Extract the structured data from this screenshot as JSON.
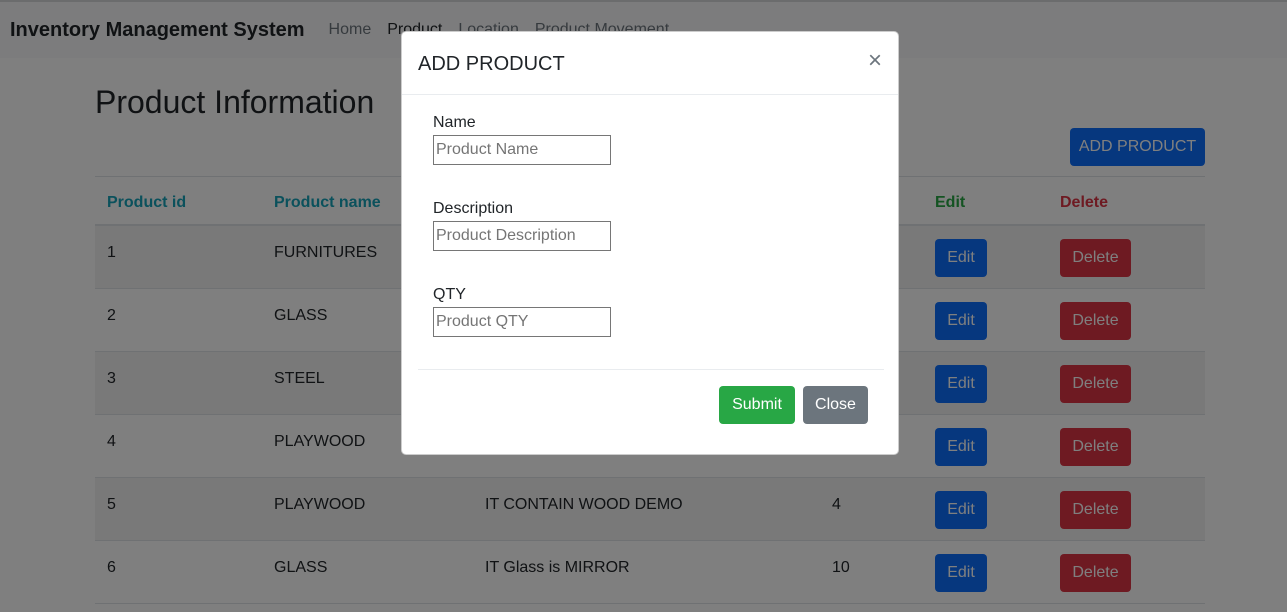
{
  "navbar": {
    "brand": "Inventory Management System",
    "links": [
      {
        "label": "Home"
      },
      {
        "label": "Product"
      },
      {
        "label": "Location"
      },
      {
        "label": "Product Movement"
      }
    ]
  },
  "page": {
    "title": "Product Information",
    "add_button": "ADD PRODUCT"
  },
  "table": {
    "headers": {
      "id": "Product id",
      "name": "Product name",
      "edit": "Edit",
      "delete": "Delete"
    },
    "rows": [
      {
        "id": "1",
        "name": "FURNITURES",
        "description": "",
        "qty": ""
      },
      {
        "id": "2",
        "name": "GLASS",
        "description": "",
        "qty": ""
      },
      {
        "id": "3",
        "name": "STEEL",
        "description": "",
        "qty": ""
      },
      {
        "id": "4",
        "name": "PLAYWOOD",
        "description": "",
        "qty": ""
      },
      {
        "id": "5",
        "name": "PLAYWOOD",
        "description": "IT CONTAIN WOOD DEMO",
        "qty": "4"
      },
      {
        "id": "6",
        "name": "GLASS",
        "description": "IT Glass is MIRROR",
        "qty": "10"
      }
    ],
    "edit_label": "Edit",
    "delete_label": "Delete"
  },
  "modal": {
    "title": "ADD PRODUCT",
    "close_glyph": "×",
    "fields": [
      {
        "label": "Name",
        "placeholder": "Product Name",
        "value": ""
      },
      {
        "label": "Description",
        "placeholder": "Product Description",
        "value": ""
      },
      {
        "label": "QTY",
        "placeholder": "Product QTY",
        "value": ""
      }
    ],
    "submit_label": "Submit",
    "close_label": "Close"
  }
}
